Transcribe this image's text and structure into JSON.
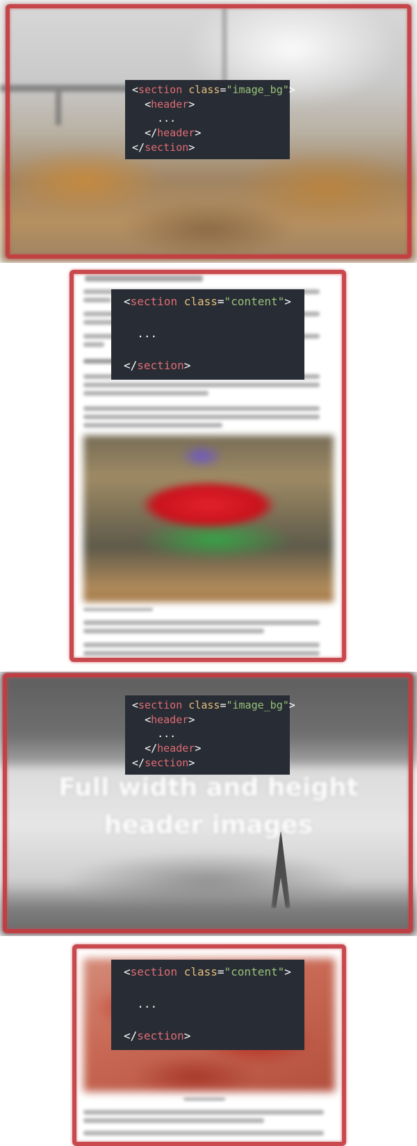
{
  "section_1": {
    "code": {
      "tag_section": "section",
      "attr_class": "class",
      "class_value": "\"image_bg\"",
      "tag_header": "header",
      "ellipsis": "..."
    }
  },
  "section_2": {
    "code": {
      "tag_section": "section",
      "attr_class": "class",
      "class_value": "\"content\"",
      "ellipsis": "..."
    }
  },
  "section_3": {
    "hero_title_line1": "Full width and height",
    "hero_title_line2": "header images",
    "code": {
      "tag_section": "section",
      "attr_class": "class",
      "class_value": "\"image_bg\"",
      "tag_header": "header",
      "ellipsis": "..."
    }
  },
  "section_4": {
    "code": {
      "tag_section": "section",
      "attr_class": "class",
      "class_value": "\"content\"",
      "ellipsis": "..."
    }
  },
  "colors": {
    "highlight_frame": "#c43a3f",
    "code_background": "#282c34",
    "code_tag": "#e06c75",
    "code_attribute": "#e5c07b",
    "code_string": "#98c379"
  }
}
